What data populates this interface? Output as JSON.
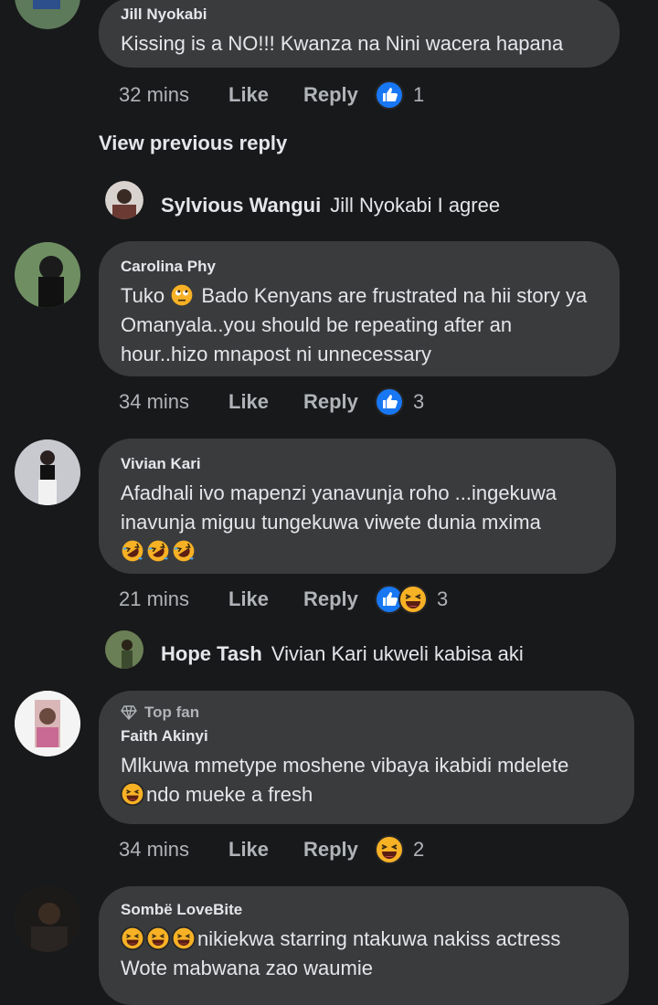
{
  "comments": [
    {
      "name": "Jill Nyokabi",
      "text": "Kissing is a NO!!!  Kwanza na Nini wacera hapana",
      "time": "32 mins",
      "like": "Like",
      "reply": "Reply",
      "count": "1"
    },
    {
      "name": "Carolina Phy",
      "text_a": "Tuko ",
      "text_b": " Bado Kenyans are frustrated na hii story ya Omanyala..you should be repeating after an hour..hizo mnapost ni unnecessary",
      "time": "34 mins",
      "like": "Like",
      "reply": "Reply",
      "count": "3"
    },
    {
      "name": "Vivian Kari",
      "text": "Afadhali ivo mapenzi yanavunja roho ...ingekuwa inavunja miguu tungekuwa viwete dunia mxima",
      "time": "21 mins",
      "like": "Like",
      "reply": "Reply",
      "count": "3"
    },
    {
      "badge": "Top fan",
      "name": "Faith Akinyi",
      "text_a": "Mlkuwa mmetype moshene vibaya ikabidi mdelete ",
      "text_b": "ndo mueke a fresh",
      "time": "34 mins",
      "like": "Like",
      "reply": "Reply",
      "count": "2"
    },
    {
      "name": "Sombë LoveBite",
      "text_a": "nikiekwa starring ntakuwa nakiss actress",
      "text_b": "Wote mabwana zao waumie"
    }
  ],
  "view_previous_reply": "View previous reply",
  "inline_replies": [
    {
      "name": "Sylvious Wangui",
      "text": "Jill Nyokabi I agree"
    },
    {
      "name": "Hope Tash",
      "text": "Vivian Kari ukweli kabisa aki"
    }
  ],
  "colors": {
    "background": "#18191a",
    "bubble": "#3a3b3c",
    "like_blue": "#1877f2",
    "haha_yellow": "#f7b125"
  }
}
